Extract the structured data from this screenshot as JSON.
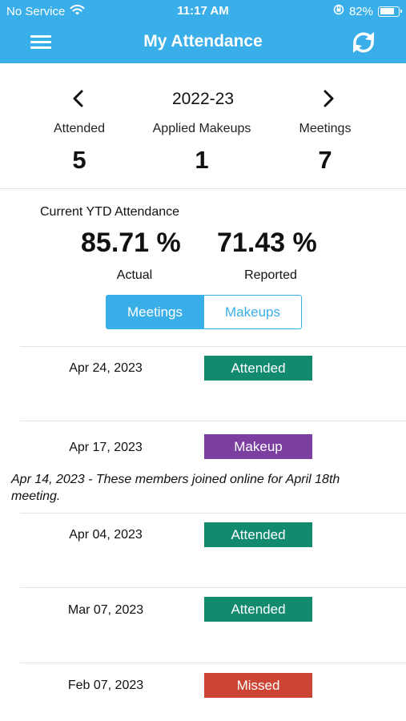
{
  "status_bar": {
    "carrier": "No Service",
    "time": "11:17 AM",
    "battery": "82%",
    "battery_level": 0.82
  },
  "nav": {
    "title": "My Attendance",
    "menu_icon": "hamburger-menu-icon",
    "refresh_icon": "refresh-icon"
  },
  "year": {
    "label": "2022-23"
  },
  "stats": [
    {
      "label": "Attended",
      "value": "5"
    },
    {
      "label": "Applied Makeups",
      "value": "1"
    },
    {
      "label": "Meetings",
      "value": "7"
    }
  ],
  "ytd": {
    "title": "Current YTD Attendance",
    "actual_value": "85.71 %",
    "actual_label": "Actual",
    "reported_value": "71.43 %",
    "reported_label": "Reported"
  },
  "tabs": {
    "meetings": "Meetings",
    "makeups": "Makeups",
    "selected": "Meetings"
  },
  "colors": {
    "header": "#3aaee8",
    "attended": "#128a6e",
    "makeup": "#7b3fa0",
    "missed": "#cc4433"
  },
  "entries": [
    {
      "date": "Apr 24, 2023",
      "status": "Attended",
      "color": "#128a6e"
    },
    {
      "date": "Apr 17, 2023",
      "status": "Makeup",
      "color": "#7b3fa0"
    },
    {
      "date": "Apr 04, 2023",
      "status": "Attended",
      "color": "#128a6e"
    },
    {
      "date": "Mar 07, 2023",
      "status": "Attended",
      "color": "#128a6e"
    },
    {
      "date": "Feb 07, 2023",
      "status": "Missed",
      "color": "#cc4433"
    }
  ],
  "note": "Apr 14, 2023 - These members joined online for April 18th meeting."
}
